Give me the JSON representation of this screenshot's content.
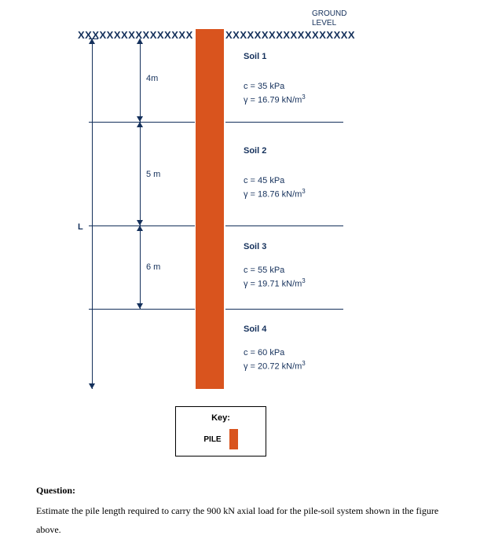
{
  "ground_level": {
    "line1": "GROUND",
    "line2": "LEVEL"
  },
  "surface_pattern_left": "XXXXXXXXXXXXXXXX",
  "surface_pattern_right": "XXXXXXXXXXXXXXXXXX",
  "axis_label": "L",
  "layers": [
    {
      "title": "Soil 1",
      "c": "c = 35 kPa",
      "gamma_prefix": "γ = 16.79 kN/m",
      "gamma_exp": "3",
      "depth_label": "4m"
    },
    {
      "title": "Soil 2",
      "c": "c = 45 kPa",
      "gamma_prefix": "γ = 18.76 kN/m",
      "gamma_exp": "3",
      "depth_label": "5 m"
    },
    {
      "title": "Soil 3",
      "c": "c = 55 kPa",
      "gamma_prefix": "γ = 19.71 kN/m",
      "gamma_exp": "3",
      "depth_label": "6 m"
    },
    {
      "title": "Soil 4",
      "c": "c = 60 kPa",
      "gamma_prefix": "γ = 20.72 kN/m",
      "gamma_exp": "3"
    }
  ],
  "key": {
    "heading": "Key:",
    "item_label": "PILE"
  },
  "question": {
    "heading": "Question:",
    "body": "Estimate the pile length required to carry the 900 kN axial load for the pile-soil system shown in the figure above."
  },
  "chart_data": {
    "type": "diagram",
    "description": "Vertical pile driven through four stacked soil layers below ground level. Layer thicknesses (top to bottom, labeled) are 4 m, 5 m, 6 m; a fourth layer (Soil 4) extends below with thickness not labeled. Total labeled depth dimension L spans from ground level to bottom of the pile.",
    "soil_layers": [
      {
        "name": "Soil 1",
        "thickness_m": 4,
        "cohesion_kPa": 35,
        "unit_weight_kN_per_m3": 16.79
      },
      {
        "name": "Soil 2",
        "thickness_m": 5,
        "cohesion_kPa": 45,
        "unit_weight_kN_per_m3": 18.76
      },
      {
        "name": "Soil 3",
        "thickness_m": 6,
        "cohesion_kPa": 55,
        "unit_weight_kN_per_m3": 19.71
      },
      {
        "name": "Soil 4",
        "thickness_m": null,
        "cohesion_kPa": 60,
        "unit_weight_kN_per_m3": 20.72
      }
    ],
    "axial_load_kN": 900,
    "unknown": "L (pile length)"
  }
}
